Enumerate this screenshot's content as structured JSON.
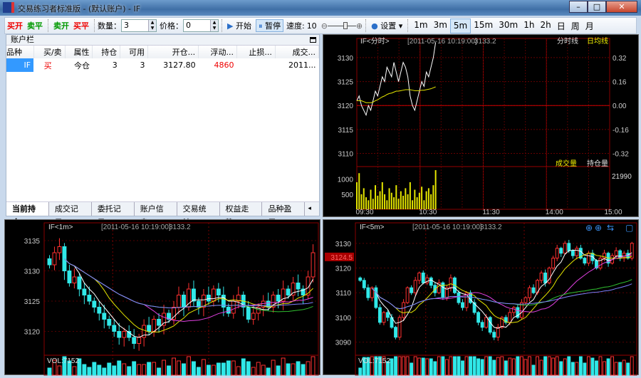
{
  "window": {
    "title": "交易练习者标准版 - (默认账户) - IF",
    "logo": "T",
    "min": "–",
    "max": "□",
    "close": "✕"
  },
  "toolbar": {
    "buy_open": "买开",
    "sell_close": "卖平",
    "sell_open": "卖开",
    "buy_close": "买平",
    "qty_label": "数量：",
    "qty_value": "3",
    "price_label": "价格：",
    "price_value": "0",
    "start": "开始",
    "pause": "暂停",
    "speed_label": "速度:",
    "speed_value": "10",
    "speed_fraction": 0.65,
    "settings": "设置",
    "periods": [
      "1m",
      "3m",
      "5m",
      "15m",
      "30m",
      "1h",
      "2h",
      "日",
      "周",
      "月"
    ],
    "active_period": "5m"
  },
  "account": {
    "title": "账户栏",
    "columns": [
      "品种",
      "买/卖",
      "属性",
      "持仓",
      "可用",
      "开仓...",
      "浮动...",
      "止损...",
      "成交..."
    ],
    "rows": [
      [
        "IF",
        "买",
        "今仓",
        "3",
        "3",
        "3127.80",
        "4860",
        "",
        "2011..."
      ]
    ],
    "tabs": [
      "当前持仓",
      "成交记录",
      "委托记录",
      "账户信息",
      "交易统计",
      "权益走势",
      "品种盈亏"
    ],
    "active_tab": "当前持仓",
    "tab_scroll": "◂ ▸"
  },
  "intraday": {
    "title": "IF<分时>",
    "time": "[2011-05-16 10:19:00]",
    "price": "3133.2",
    "legend_line": "分时线",
    "legend_avg": "日均线",
    "vol_label": "成交量",
    "oi_label": "持仓量",
    "oi_value": "21990",
    "price_ticks": [
      "3130",
      "3125",
      "3120",
      "3115",
      "3110"
    ],
    "pct_ticks": [
      "0.32",
      "0.16",
      "0.00",
      "-0.16",
      "-0.32"
    ],
    "vol_ticks": [
      "1000",
      "500"
    ],
    "time_ticks": [
      "09:30",
      "10:30",
      "11:30",
      "14:00",
      "15:00"
    ],
    "colors": {
      "line": "#ffffff",
      "avg": "#e5e500",
      "vol": "#e5e500"
    }
  },
  "chart_data": [
    {
      "type": "line",
      "title": "IF<分时>",
      "ylim": [
        3108,
        3134
      ],
      "baseline": 3120,
      "x_count": 240,
      "values": [
        3121,
        3122,
        3120,
        3119,
        3118,
        3120,
        3119,
        3121,
        3123,
        3122,
        3124,
        3126,
        3125,
        3128,
        3127,
        3126,
        3129,
        3127,
        3125,
        3127,
        3129,
        3128,
        3126,
        3122,
        3120,
        3119,
        3121,
        3123,
        3125,
        3124,
        3127,
        3126,
        3128,
        3130,
        3133.2
      ],
      "avg": [
        3121,
        3121,
        3121,
        3120.8,
        3120.6,
        3120.6,
        3120.6,
        3120.7,
        3121,
        3121.2,
        3121.5,
        3121.8,
        3122,
        3122.3,
        3122.5,
        3122.6,
        3122.8,
        3123,
        3123,
        3123.1,
        3123.2,
        3123.3,
        3123.3,
        3123.3,
        3123.2,
        3123.1,
        3123.1,
        3123.1,
        3123.2,
        3123.2,
        3123.3,
        3123.4,
        3123.5,
        3123.7,
        3123.9
      ],
      "volume": [
        900,
        1200,
        500,
        700,
        400,
        300,
        650,
        350,
        800,
        450,
        600,
        900,
        500,
        300,
        700,
        550,
        400,
        800,
        350,
        600,
        450,
        700,
        500,
        900,
        300,
        650,
        400,
        550,
        750,
        300,
        600,
        700,
        500,
        800,
        1300
      ]
    },
    {
      "type": "candlestick",
      "title": "IF<1m>",
      "time": "[2011-05-16 10:19:00]",
      "price": "3133.2",
      "vol_label": "VOL:7152",
      "ylim": [
        3117,
        3137
      ],
      "y_ticks": [
        "3135",
        "3130",
        "3125",
        "3120"
      ],
      "closes": [
        3131,
        3133,
        3134,
        3130,
        3128,
        3129,
        3127,
        3126,
        3125,
        3124,
        3123,
        3122,
        3121,
        3120,
        3119,
        3120,
        3119,
        3118,
        3119,
        3121,
        3120,
        3122,
        3121,
        3123,
        3122,
        3124,
        3126,
        3124,
        3127,
        3125,
        3124,
        3126,
        3125,
        3127,
        3126,
        3124,
        3123,
        3125,
        3126,
        3124,
        3122,
        3123,
        3124,
        3125,
        3124,
        3126,
        3125,
        3127,
        3126,
        3128,
        3127,
        3126,
        3129,
        3133
      ]
    },
    {
      "type": "candlestick",
      "title": "IF<5m>",
      "time": "[2011-05-16 10:19:00]",
      "price": "3133.2",
      "vol_label": "VOL:7152",
      "marker": "3124.5",
      "ylim": [
        3087,
        3136
      ],
      "y_ticks": [
        "3130",
        "3120",
        "3110",
        "3100",
        "3090"
      ],
      "closes": [
        3115,
        3112,
        3108,
        3112,
        3104,
        3098,
        3102,
        3100,
        3096,
        3092,
        3100,
        3106,
        3112,
        3110,
        3115,
        3118,
        3114,
        3116,
        3113,
        3110,
        3114,
        3108,
        3112,
        3116,
        3110,
        3106,
        3104,
        3110,
        3106,
        3102,
        3098,
        3096,
        3100,
        3094,
        3092,
        3096,
        3100,
        3098,
        3102,
        3104,
        3100,
        3106,
        3108,
        3112,
        3110,
        3115,
        3118,
        3114,
        3120,
        3124,
        3128,
        3126,
        3130,
        3127,
        3125,
        3128,
        3124,
        3122,
        3126,
        3123,
        3120,
        3124,
        3126,
        3122,
        3125,
        3127,
        3124,
        3126,
        3124,
        3130
      ]
    }
  ]
}
